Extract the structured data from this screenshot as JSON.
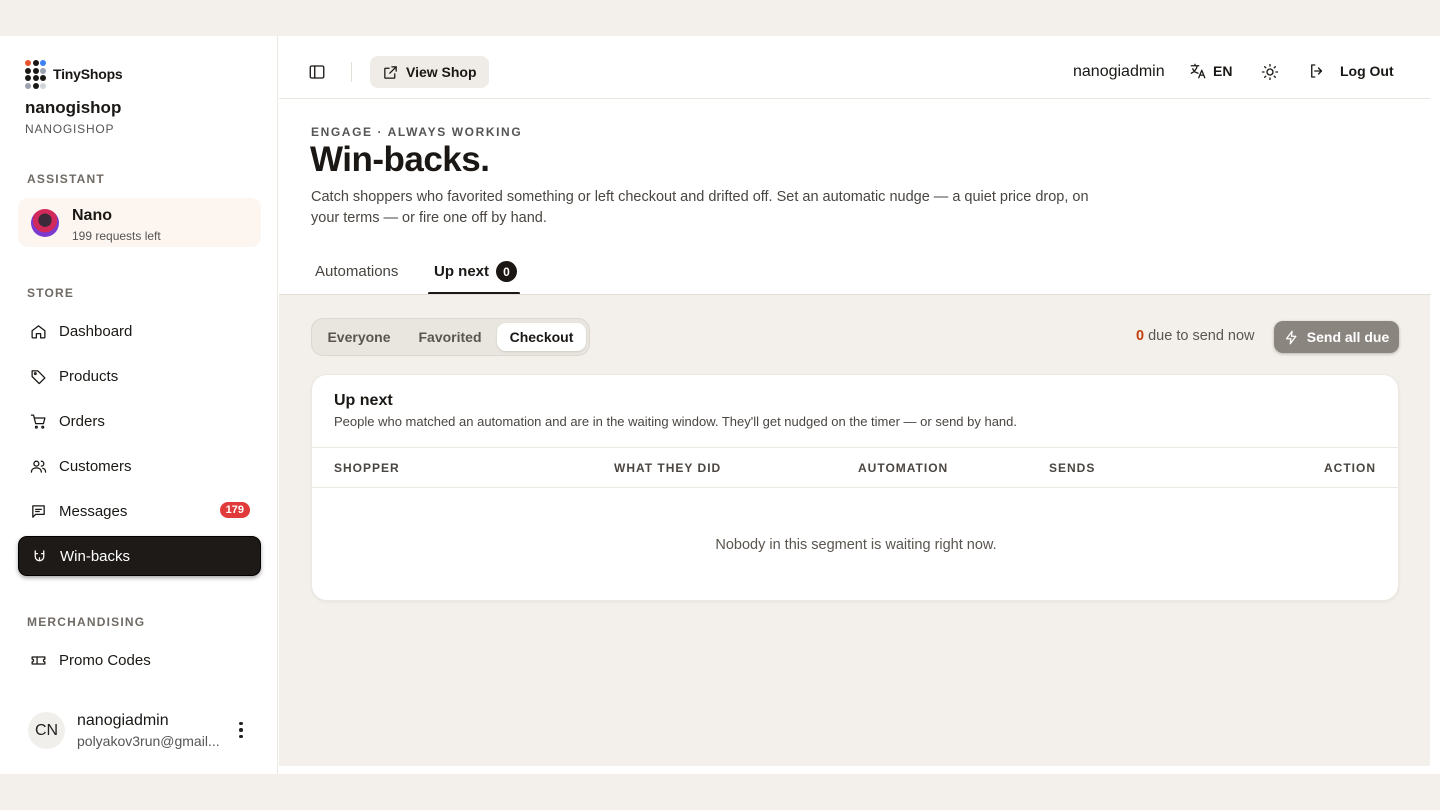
{
  "brand": {
    "name": "TinyShops",
    "dot_colors": [
      "#e8542c",
      "#1a1714",
      "#3b82f6",
      "#1a1714",
      "#1a1714",
      "#9ca3af",
      "#1a1714",
      "#1a1714",
      "#1a1714",
      "#9ca3af",
      "#1a1714",
      "#d1d5db"
    ]
  },
  "shop": {
    "name": "nanogishop",
    "sub": "NANOGISHOP"
  },
  "sidebar": {
    "assistant_label": "ASSISTANT",
    "assistant": {
      "name": "Nano",
      "sub": "199 requests left"
    },
    "store_label": "STORE",
    "store_items": [
      {
        "label": "Dashboard",
        "icon": "home-icon"
      },
      {
        "label": "Products",
        "icon": "tag-icon"
      },
      {
        "label": "Orders",
        "icon": "cart-icon"
      },
      {
        "label": "Customers",
        "icon": "users-icon"
      },
      {
        "label": "Messages",
        "icon": "message-icon",
        "badge": "179"
      },
      {
        "label": "Win-backs",
        "icon": "magnet-icon",
        "active": true
      }
    ],
    "merch_label": "MERCHANDISING",
    "merch_items": [
      {
        "label": "Promo Codes",
        "icon": "ticket-icon"
      }
    ],
    "user": {
      "initials": "CN",
      "name": "nanogiadmin",
      "email": "polyakov3run@gmail..."
    }
  },
  "topbar": {
    "view_shop": "View Shop",
    "user": "nanogiadmin",
    "lang": "EN",
    "logout": "Log Out"
  },
  "header": {
    "kicker": "ENGAGE · ALWAYS WORKING",
    "title": "Win-backs.",
    "description": "Catch shoppers who favorited something or left checkout and drifted off. Set an automatic nudge — a quiet price drop, on your terms — or fire one off by hand."
  },
  "tabs": [
    {
      "label": "Automations"
    },
    {
      "label": "Up next",
      "count": "0",
      "active": true
    }
  ],
  "segments": {
    "items": [
      "Everyone",
      "Favorited",
      "Checkout"
    ],
    "selected": "Checkout"
  },
  "due": {
    "count": "0",
    "text": "due to send now",
    "button": "Send all due"
  },
  "card": {
    "title": "Up next",
    "subtitle": "People who matched an automation and are in the waiting window. They'll get nudged on the timer — or send by hand.",
    "columns": [
      "SHOPPER",
      "WHAT THEY DID",
      "AUTOMATION",
      "SENDS",
      "ACTION"
    ],
    "empty": "Nobody in this segment is waiting right now."
  }
}
